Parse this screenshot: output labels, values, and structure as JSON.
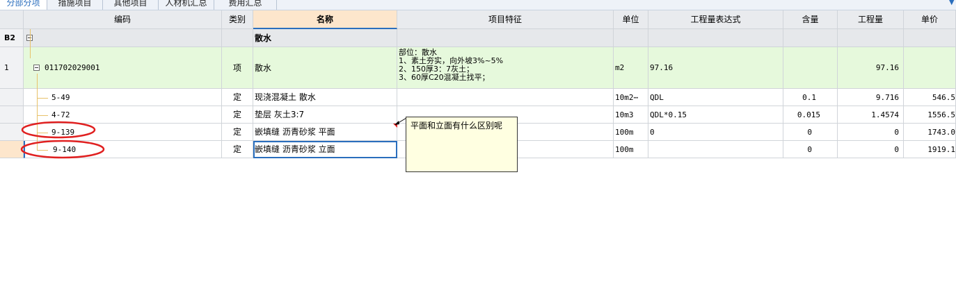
{
  "tabs": [
    "分部分项",
    "措施项目",
    "其他项目",
    "人材机汇总",
    "费用汇总"
  ],
  "columns": [
    "编码",
    "类别",
    "名称",
    "项目特征",
    "单位",
    "工程量表达式",
    "含量",
    "工程量",
    "单价"
  ],
  "rows": [
    {
      "num": "B2",
      "code": "",
      "type": "",
      "name": "散水",
      "feature": "",
      "unit": "",
      "expr": "",
      "content": "",
      "qty": "",
      "price": ""
    },
    {
      "num": "1",
      "code": "011702029001",
      "type": "项",
      "name": "散水",
      "feature": "部位：散水\n1、素土夯实，向外坡3%~5%\n2、150厚3：7灰土；\n3、60厚C20混凝土找平；",
      "unit": "m2",
      "expr": "97.16",
      "content": "",
      "qty": "97.16",
      "price": ""
    },
    {
      "num": "",
      "code": "5-49",
      "type": "定",
      "name": "现浇混凝土 散水",
      "feature": "",
      "unit": "10m2⋯",
      "expr": "QDL",
      "content": "0.1",
      "qty": "9.716",
      "price": "546.5"
    },
    {
      "num": "",
      "code": "4-72",
      "type": "定",
      "name": "垫层 灰土3:7",
      "feature": "",
      "unit": "10m3",
      "expr": "QDL*0.15",
      "content": "0.015",
      "qty": "1.4574",
      "price": "1556.5"
    },
    {
      "num": "",
      "code": "9-139",
      "type": "定",
      "name": "嵌填缝 沥青砂浆 平面",
      "feature": "",
      "unit": "100m",
      "expr": "0",
      "content": "0",
      "qty": "0",
      "price": "1743.0"
    },
    {
      "num": "",
      "code": "9-140",
      "type": "定",
      "name": "嵌填缝 沥青砂浆 立面",
      "feature": "",
      "unit": "100m",
      "expr": "",
      "content": "0",
      "qty": "0",
      "price": "1919.1"
    }
  ],
  "comment": "平面和立面有什么区别呢",
  "colors": {
    "header": "#e9ebee",
    "selected_header": "#fde6cc",
    "item_row": "#e6f9dc",
    "group_row": "#e6e8eb",
    "annotation": "#e02020",
    "accent": "#2a6ebd"
  }
}
